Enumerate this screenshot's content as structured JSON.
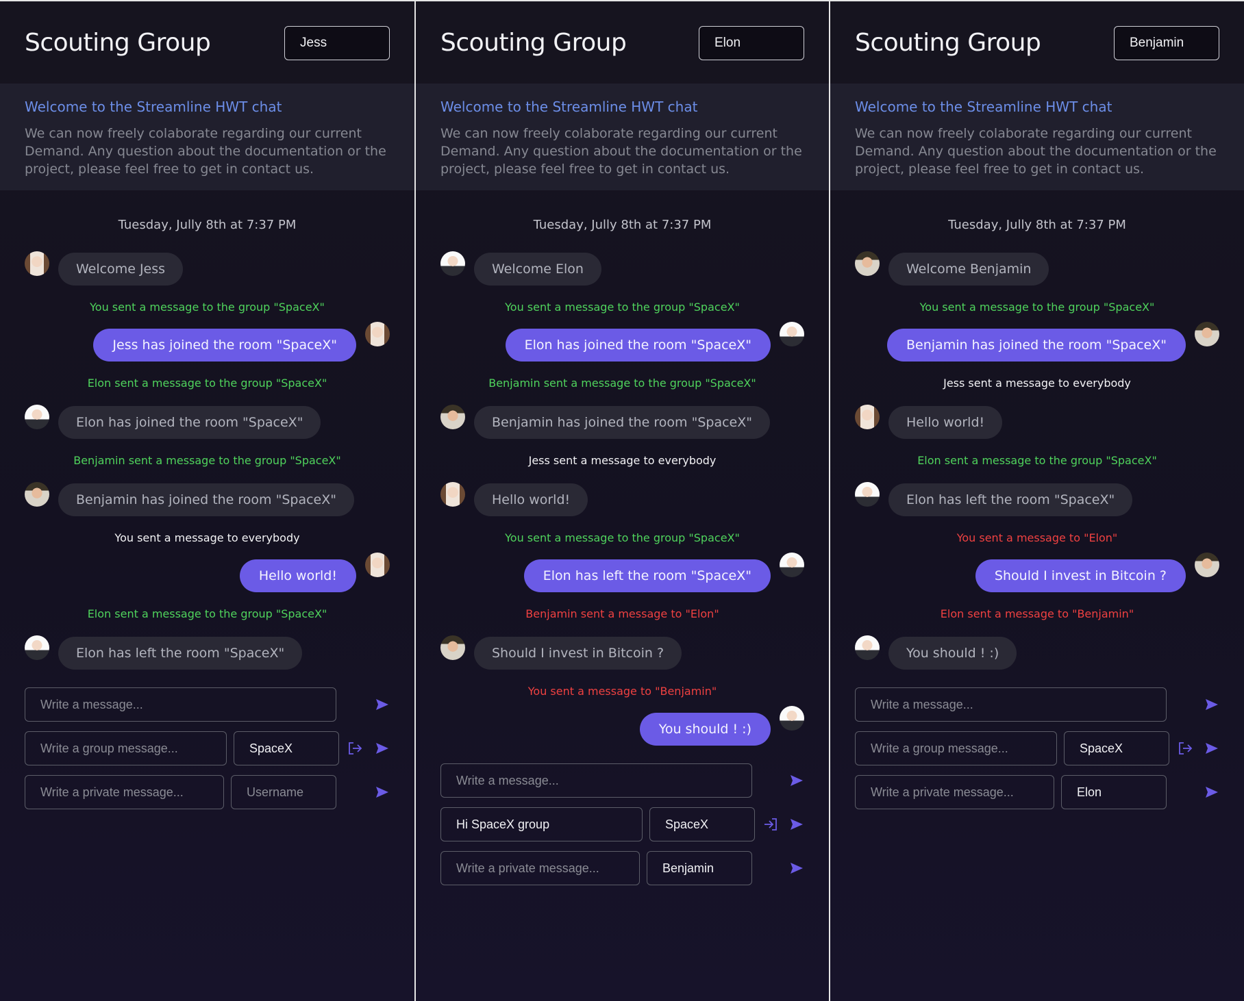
{
  "colors": {
    "accent": "#6b5be6",
    "green": "#4fd35c",
    "red": "#ef4141",
    "link": "#6c8ee8"
  },
  "panels": [
    {
      "title": "Scouting Group",
      "username": "Jess",
      "welcome_title": "Welcome to the Streamline HWT chat",
      "welcome_text": "We can now freely colaborate regarding our current Demand. Any question about the documentation or the project, please feel free to get in contact us.",
      "date": "Tuesday, Jully 8th at 7:37 PM",
      "messages": [
        {
          "dir": "in",
          "avatar": "jess",
          "text": "Welcome Jess"
        },
        {
          "notice": "You sent a message to the group \"SpaceX\"",
          "color": "green"
        },
        {
          "dir": "out",
          "avatar": "jess",
          "text": "Jess has joined the room \"SpaceX\""
        },
        {
          "notice": "Elon sent a message to the group \"SpaceX\"",
          "color": "green"
        },
        {
          "dir": "in",
          "avatar": "elon",
          "text": "Elon has joined the room \"SpaceX\""
        },
        {
          "notice": "Benjamin sent a message to the group \"SpaceX\"",
          "color": "green"
        },
        {
          "dir": "in",
          "avatar": "benj",
          "text": "Benjamin has joined the room \"SpaceX\""
        },
        {
          "notice": "You sent a message to everybody",
          "color": "white"
        },
        {
          "dir": "out",
          "avatar": "jess",
          "text": "Hello world!"
        },
        {
          "notice": "Elon sent a message to the group \"SpaceX\"",
          "color": "green"
        },
        {
          "dir": "in",
          "avatar": "elon",
          "text": "Elon has left the room \"SpaceX\""
        }
      ],
      "message_input": {
        "value": "",
        "placeholder": "Write a message..."
      },
      "group_input": {
        "value": "",
        "placeholder": "Write a group message..."
      },
      "room_input": {
        "value": "SpaceX",
        "placeholder": ""
      },
      "group_action_icon": "leave-room-icon",
      "private_input": {
        "value": "",
        "placeholder": "Write a private message..."
      },
      "recipient_input": {
        "value": "",
        "placeholder": "Username"
      }
    },
    {
      "title": "Scouting Group",
      "username": "Elon",
      "welcome_title": "Welcome to the Streamline HWT chat",
      "welcome_text": "We can now freely colaborate regarding our current Demand. Any question about the documentation or the project, please feel free to get in contact us.",
      "date": "Tuesday, Jully 8th at 7:37 PM",
      "messages": [
        {
          "dir": "in",
          "avatar": "elon",
          "text": "Welcome Elon"
        },
        {
          "notice": "You sent a message to the group \"SpaceX\"",
          "color": "green"
        },
        {
          "dir": "out",
          "avatar": "elon",
          "text": "Elon has joined the room \"SpaceX\""
        },
        {
          "notice": "Benjamin sent a message to the group \"SpaceX\"",
          "color": "green"
        },
        {
          "dir": "in",
          "avatar": "benj",
          "text": "Benjamin has joined the room \"SpaceX\""
        },
        {
          "notice": "Jess sent a message to everybody",
          "color": "white"
        },
        {
          "dir": "in",
          "avatar": "jess",
          "text": "Hello world!"
        },
        {
          "notice": "You sent a message to the group \"SpaceX\"",
          "color": "green"
        },
        {
          "dir": "out",
          "avatar": "elon",
          "text": "Elon has left the room \"SpaceX\""
        },
        {
          "notice": "Benjamin sent a message to \"Elon\"",
          "color": "red"
        },
        {
          "dir": "in",
          "avatar": "benj",
          "text": "Should I invest in Bitcoin ?"
        },
        {
          "notice": "You sent a message to \"Benjamin\"",
          "color": "red"
        },
        {
          "dir": "out",
          "avatar": "elon",
          "text": "You should ! :)"
        }
      ],
      "message_input": {
        "value": "",
        "placeholder": "Write a message..."
      },
      "group_input": {
        "value": "Hi SpaceX group",
        "placeholder": "Write a group message..."
      },
      "room_input": {
        "value": "SpaceX",
        "placeholder": ""
      },
      "group_action_icon": "join-room-icon",
      "private_input": {
        "value": "",
        "placeholder": "Write a private message..."
      },
      "recipient_input": {
        "value": "Benjamin",
        "placeholder": "Username"
      }
    },
    {
      "title": "Scouting Group",
      "username": "Benjamin",
      "welcome_title": "Welcome to the Streamline HWT chat",
      "welcome_text": "We can now freely colaborate regarding our current Demand. Any question about the documentation or the project, please feel free to get in contact us.",
      "date": "Tuesday, Jully 8th at 7:37 PM",
      "messages": [
        {
          "dir": "in",
          "avatar": "benj",
          "text": "Welcome Benjamin"
        },
        {
          "notice": "You sent a message to the group \"SpaceX\"",
          "color": "green"
        },
        {
          "dir": "out",
          "avatar": "benj",
          "text": "Benjamin has joined the room \"SpaceX\""
        },
        {
          "notice": "Jess sent a message to everybody",
          "color": "white"
        },
        {
          "dir": "in",
          "avatar": "jess",
          "text": "Hello world!"
        },
        {
          "notice": "Elon sent a message to the group \"SpaceX\"",
          "color": "green"
        },
        {
          "dir": "in",
          "avatar": "elon",
          "text": "Elon has left the room \"SpaceX\""
        },
        {
          "notice": "You sent a message to \"Elon\"",
          "color": "red"
        },
        {
          "dir": "out",
          "avatar": "benj",
          "text": "Should I invest in Bitcoin ?"
        },
        {
          "notice": "Elon sent a message to \"Benjamin\"",
          "color": "red"
        },
        {
          "dir": "in",
          "avatar": "elon",
          "text": "You should ! :)"
        }
      ],
      "message_input": {
        "value": "",
        "placeholder": "Write a message..."
      },
      "group_input": {
        "value": "",
        "placeholder": "Write a group message..."
      },
      "room_input": {
        "value": "SpaceX",
        "placeholder": ""
      },
      "group_action_icon": "leave-room-icon",
      "private_input": {
        "value": "",
        "placeholder": "Write a private message..."
      },
      "recipient_input": {
        "value": "Elon",
        "placeholder": "Username"
      }
    }
  ]
}
